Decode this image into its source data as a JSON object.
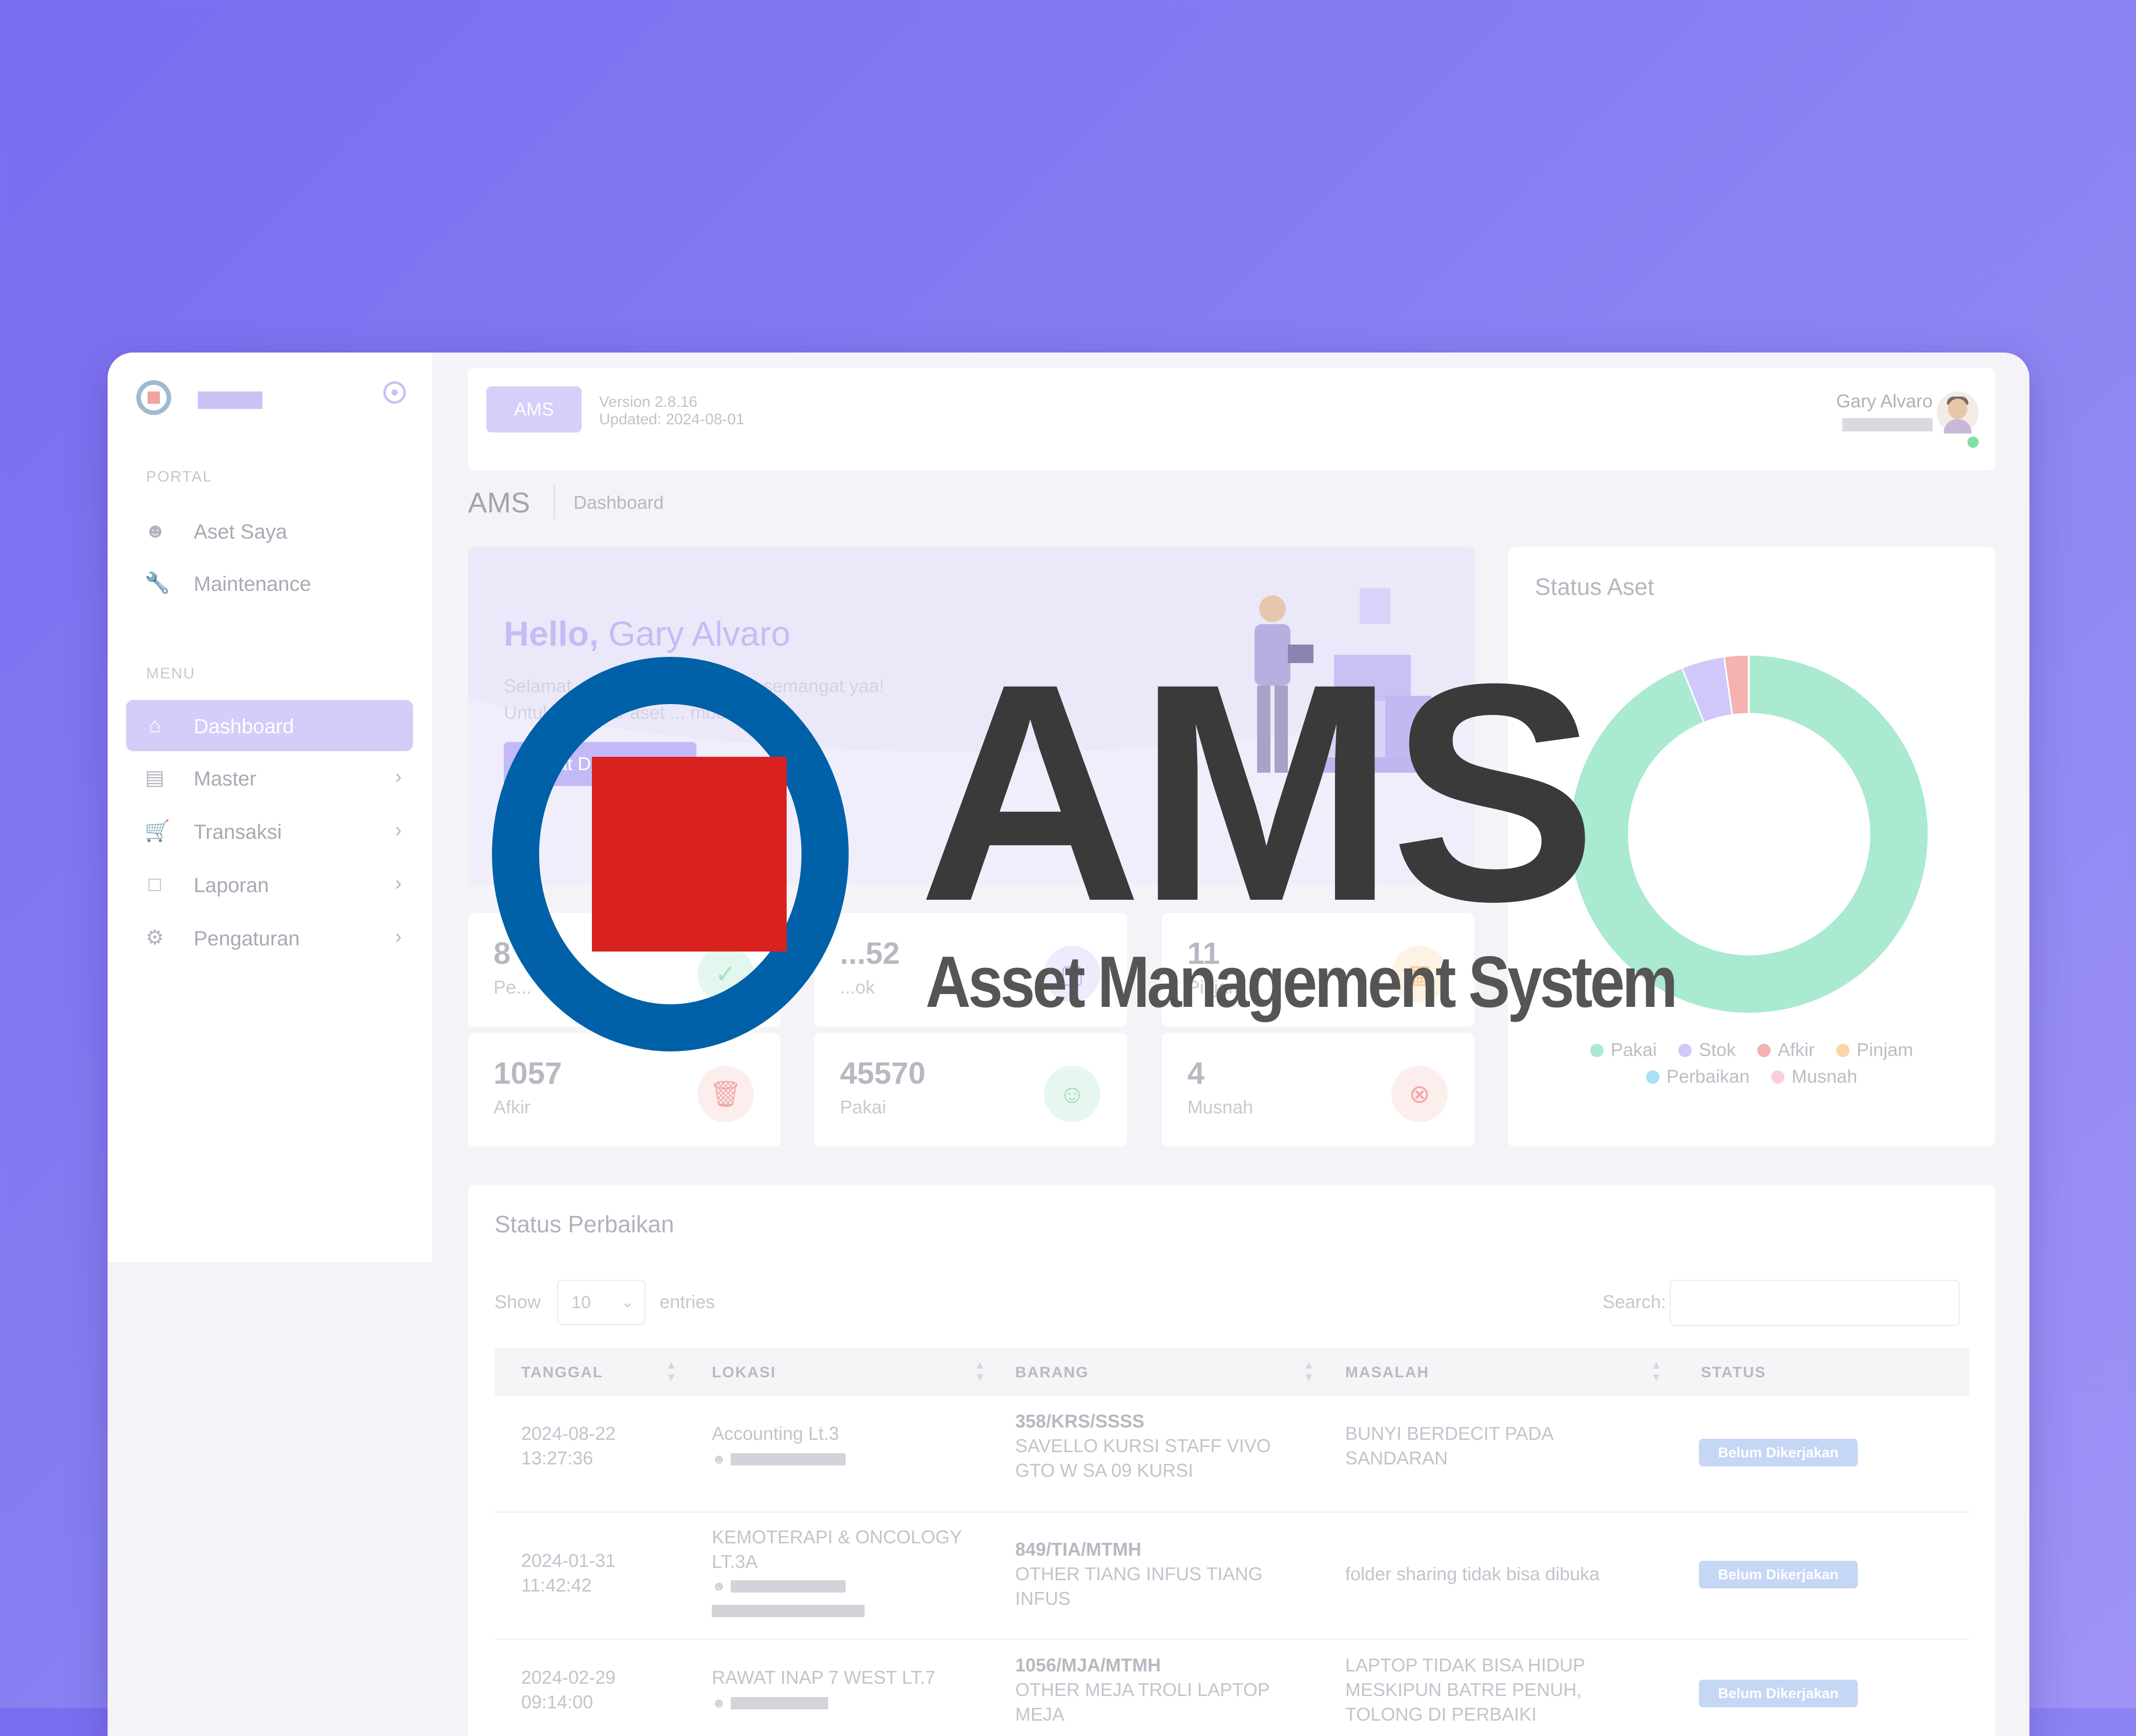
{
  "sidebar": {
    "sections": {
      "portal": "PORTAL",
      "menu": "MENU"
    },
    "portal_items": [
      {
        "label": "Aset Saya",
        "icon": "user-icon"
      },
      {
        "label": "Maintenance",
        "icon": "wrench-icon"
      }
    ],
    "menu_items": [
      {
        "label": "Dashboard",
        "icon": "home-icon",
        "active": true
      },
      {
        "label": "Master",
        "icon": "book-icon"
      },
      {
        "label": "Transaksi",
        "icon": "cart-icon"
      },
      {
        "label": "Laporan",
        "icon": "file-icon"
      },
      {
        "label": "Pengaturan",
        "icon": "gear-icon"
      }
    ]
  },
  "topbar": {
    "app_chip": "AMS",
    "version": "Version 2.8.16",
    "updated": "Updated: 2024-08-01",
    "user_name": "Gary Alvaro"
  },
  "page": {
    "title": "AMS",
    "breadcrumb": "Dashboard"
  },
  "hero": {
    "greeting": "Hello,",
    "name": "Gary Alvaro",
    "line1": "Selamat ... gu ini semoga tetap semangat yaa!",
    "line2": "Untuk ... daftar aset ... mbol berikut:",
    "button": "Lihat D..."
  },
  "stats": [
    {
      "value": "8",
      "label": "Pe...",
      "icon": "check-icon"
    },
    {
      "value": "...52",
      "label": "...ok",
      "icon": "box-icon"
    },
    {
      "value": "11",
      "label": "Pinjam",
      "icon": "archive-icon"
    },
    {
      "value": "1057",
      "label": "Afkir",
      "icon": "trash-icon"
    },
    {
      "value": "45570",
      "label": "Pakai",
      "icon": "users-icon"
    },
    {
      "value": "4",
      "label": "Musnah",
      "icon": "x-circle-icon"
    }
  ],
  "status_card": {
    "title": "Status Aset"
  },
  "chart_data": {
    "type": "pie",
    "labels": [
      "Pakai",
      "Stok",
      "Afkir",
      "Pinjam",
      "Perbaikan",
      "Musnah"
    ],
    "values": [
      45570,
      1880,
      1057,
      11,
      8,
      4
    ],
    "colors": [
      "#a9ead0",
      "#cfc8f8",
      "#f6b1b1",
      "#fad8a6",
      "#a6e3f3",
      "#fad0d8"
    ],
    "legend_position": "bottom",
    "donut": true
  },
  "table": {
    "title": "Status Perbaikan",
    "show_label": "Show",
    "entries_value": "10",
    "entries_label": "entries",
    "search_label": "Search:",
    "columns": [
      "TANGGAL",
      "LOKASI",
      "BARANG",
      "MASALAH",
      "STATUS"
    ],
    "rows": [
      {
        "date": "2024-08-22",
        "time": "13:27:36",
        "loc1": "Accounting Lt.3",
        "loc2": "",
        "code": "358/KRS/SSSS",
        "item1": "SAVELLO KURSI STAFF VIVO",
        "item2": "GTO W SA 09 KURSI",
        "issue1": "BUNYI BERDECIT PADA",
        "issue2": "SANDARAN",
        "status": "Belum Dikerjakan"
      },
      {
        "date": "2024-01-31",
        "time": "11:42:42",
        "loc1": "KEMOTERAPI & ONCOLOGY",
        "loc2": "LT.3A",
        "code": "849/TIA/MTMH",
        "item1": "OTHER TIANG INFUS TIANG",
        "item2": "INFUS",
        "issue1": "folder sharing tidak bisa dibuka",
        "issue2": "",
        "status": "Belum Dikerjakan"
      },
      {
        "date": "2024-02-29",
        "time": "09:14:00",
        "loc1": "RAWAT INAP 7 WEST LT.7",
        "loc2": "",
        "code": "1056/MJA/MTMH",
        "item1": "OTHER MEJA TROLI LAPTOP",
        "item2": "MEJA",
        "issue1": "LAPTOP TIDAK BISA HIDUP",
        "issue2": "MESKIPUN BATRE PENUH,",
        "issue3": "TOLONG DI PERBAIKI",
        "status": "Belum Dikerjakan"
      }
    ]
  },
  "logo": {
    "wordmark": "AMS",
    "tagline": "Asset Management System",
    "ring_color": "#0060a8",
    "square_color": "#d9221f"
  }
}
